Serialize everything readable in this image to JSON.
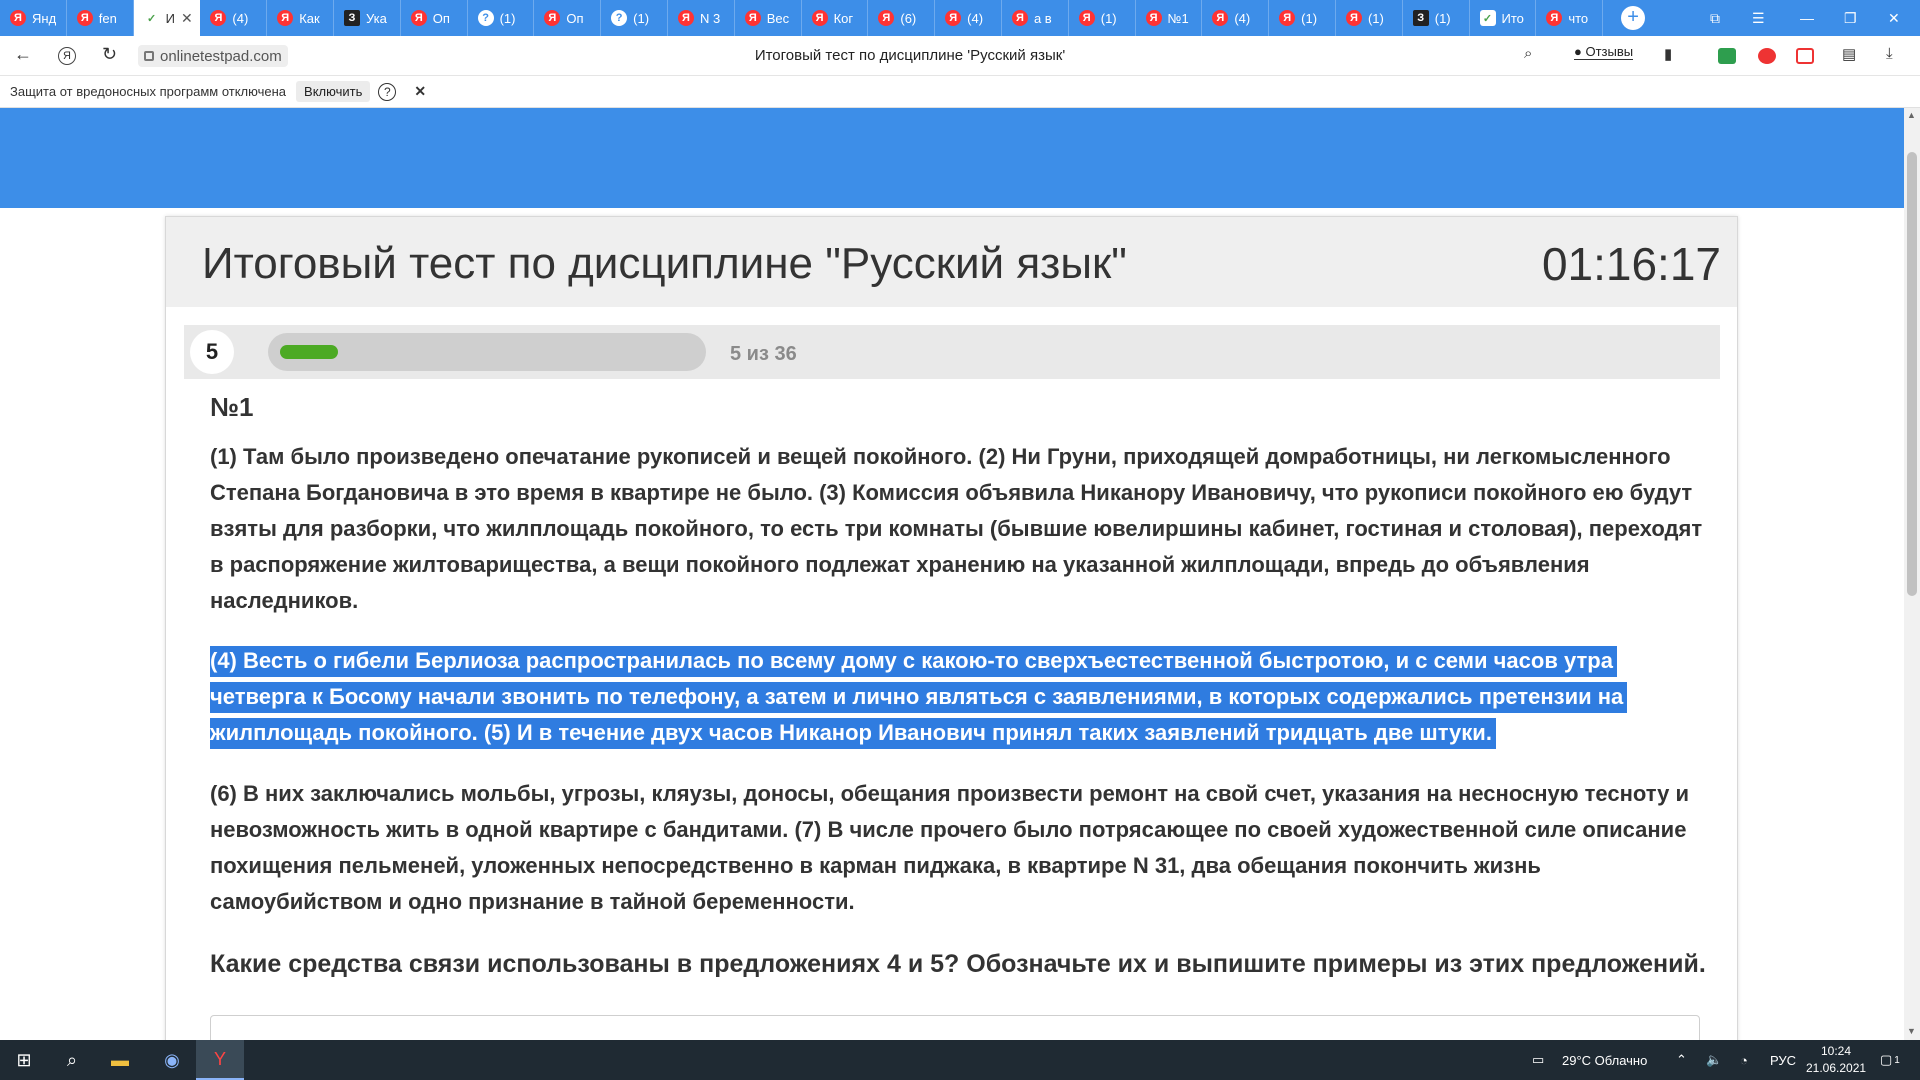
{
  "browser": {
    "tabs": [
      {
        "icon": "yandex",
        "label": "Янд",
        "active": false
      },
      {
        "icon": "yandex",
        "label": "fen",
        "active": false
      },
      {
        "icon": "testpad",
        "label": "И",
        "active": true
      },
      {
        "icon": "yandex",
        "label": "(4)",
        "active": false
      },
      {
        "icon": "yandex",
        "label": "Как",
        "active": false
      },
      {
        "icon": "znanija",
        "label": "Ука",
        "active": false
      },
      {
        "icon": "yandex",
        "label": "Оп",
        "active": false
      },
      {
        "icon": "question",
        "label": "(1)",
        "active": false
      },
      {
        "icon": "yandex",
        "label": "Оп",
        "active": false
      },
      {
        "icon": "question",
        "label": "(1)",
        "active": false
      },
      {
        "icon": "yandex",
        "label": "N 3",
        "active": false
      },
      {
        "icon": "yandex",
        "label": "Вес",
        "active": false
      },
      {
        "icon": "yandex",
        "label": "Ког",
        "active": false
      },
      {
        "icon": "yandex",
        "label": "(6)",
        "active": false
      },
      {
        "icon": "yandex",
        "label": "(4)",
        "active": false
      },
      {
        "icon": "yandex",
        "label": "а в",
        "active": false
      },
      {
        "icon": "yandex",
        "label": "(1)",
        "active": false
      },
      {
        "icon": "yandex",
        "label": "№1",
        "active": false
      },
      {
        "icon": "yandex",
        "label": "(4)",
        "active": false
      },
      {
        "icon": "yandex",
        "label": "(1)",
        "active": false
      },
      {
        "icon": "yandex",
        "label": "(1)",
        "active": false
      },
      {
        "icon": "znanija",
        "label": "(1)",
        "active": false
      },
      {
        "icon": "testpad",
        "label": "Ито",
        "active": false
      },
      {
        "icon": "yandex",
        "label": "что",
        "active": false
      }
    ],
    "url": "onlinetestpad.com",
    "page_title": "Итоговый тест по дисциплине 'Русский язык'",
    "reviews_label": "Отзывы",
    "protection_text": "Защита от вредоносных программ отключена",
    "enable_label": "Включить",
    "accent_color": "#3d8ee8"
  },
  "test": {
    "title": "Итоговый тест по дисциплине \"Русский язык\"",
    "timer": "01:16:17",
    "question_number": "5",
    "progress_text": "5 из 36",
    "progress_current": 5,
    "progress_total": 36,
    "task_label": "№1",
    "paragraph1": "(1) Там было произведено опечатание рукописей и вещей покойного. (2) Ни Груни, приходящей домработницы, ни легкомысленного Степана Богдановича в это время в квартире не было. (3) Комиссия объявила Никанору Ивановичу, что рукописи покойного ею будут взяты для разборки, что жилплощадь покойного, то есть три комнаты (бывшие ювелиршины кабинет, гостиная и столовая), переходят в распоряжение жилтоварищества, а вещи покойного подлежат хранению на указанной жилплощади, впредь до объявления наследников.",
    "paragraph2": "(4) Весть о гибели Берлиоза распространилась по всему дому с какою-то сверхъестественной быстротою, и с семи часов утра четверга к Босому начали звонить по телефону, а затем и лично являться с заявлениями, в которых содержались претензии на жилплощадь покойного. (5) И в течение двух часов Никанор Иванович принял таких заявлений тридцать две штуки.",
    "paragraph3": "(6) В них заключались мольбы, угрозы, кляузы, доносы, обещания произвести ремонт на свой счет, указания на несносную тесноту и невозможность жить в одной квартире с бандитами. (7) В числе прочего было потрясающее по своей художественной силе описание похищения пельменей, уложенных непосредственно в карман пиджака, в квартире N 31, два обещания покончить жизнь самоубийством и одно признание в тайной беременности.",
    "question": "Какие средства связи использованы в предложениях 4 и 5? Обозначьте их и выпишите примеры из этих предложений."
  },
  "taskbar": {
    "weather": "29°C Облачно",
    "language": "РУС",
    "time": "10:24",
    "date": "21.06.2021",
    "notification_count": "1"
  }
}
